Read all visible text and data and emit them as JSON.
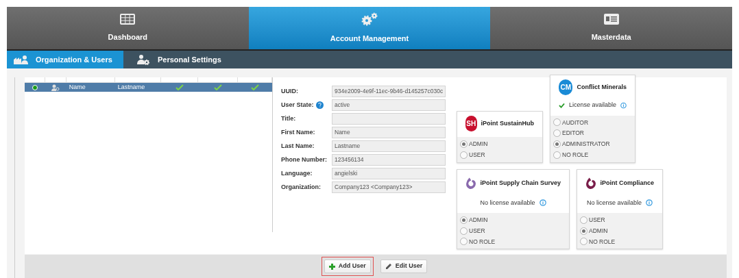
{
  "nav": [
    {
      "label": "Dashboard",
      "kind": "grid",
      "selected": false
    },
    {
      "label": "Account Management",
      "kind": "gears",
      "selected": true
    },
    {
      "label": "Masterdata",
      "kind": "card",
      "selected": false
    }
  ],
  "subnav": [
    {
      "label": "Organization & Users",
      "kind": "org",
      "selected": true
    },
    {
      "label": "Personal Settings",
      "kind": "settings",
      "selected": false
    }
  ],
  "table": {
    "rows": [
      {
        "color": "#1a9a1a",
        "first_name": "Name",
        "last_name": "Lastname",
        "checks": [
          true,
          true,
          true
        ],
        "selected": true
      }
    ]
  },
  "form": [
    {
      "label": "UUID:",
      "value": "934e2009-4e9f-11ec-9b46-d145257c030c"
    },
    {
      "label": "User State:",
      "value": "active",
      "help": true
    },
    {
      "label": "Title:"
    },
    {
      "label": "First Name:",
      "value": "Name"
    },
    {
      "label": "Last Name:",
      "value": "Lastname"
    },
    {
      "label": "Phone Number:",
      "value": "123456134"
    },
    {
      "label": "Language:",
      "value": "angielski"
    },
    {
      "label": "Organization:",
      "value": "Company123 <Company123>"
    }
  ],
  "licenses": [
    {
      "title": "iPoint SustainHub",
      "kind": "badge",
      "badge": "SH",
      "color": "#c8102e",
      "roles": [
        {
          "label": "ADMIN",
          "selected": true
        },
        {
          "label": "USER",
          "selected": false
        }
      ]
    },
    {
      "title": "Conflict Minerals",
      "kind": "badge",
      "badge": "CM",
      "color": "#1a8bd6",
      "license": {
        "available": true,
        "text": "License available"
      },
      "roles": [
        {
          "label": "AUDITOR",
          "selected": false
        },
        {
          "label": "EDITOR",
          "selected": false
        },
        {
          "label": "ADMINISTRATOR",
          "selected": true
        },
        {
          "label": "NO ROLE",
          "selected": false
        }
      ]
    },
    {
      "title": "iPoint Supply Chain Survey",
      "kind": "swirl",
      "color": "#8a6aad",
      "license": {
        "available": false,
        "text": "No license available"
      },
      "roles": [
        {
          "label": "ADMIN",
          "selected": true
        },
        {
          "label": "USER",
          "selected": false
        },
        {
          "label": "NO ROLE",
          "selected": false
        }
      ]
    },
    {
      "title": "iPoint Compliance",
      "kind": "swirl",
      "color": "#7a1e4a",
      "license": {
        "available": false,
        "text": "No license available"
      },
      "roles": [
        {
          "label": "USER",
          "selected": false
        },
        {
          "label": "ADMIN",
          "selected": true
        },
        {
          "label": "NO ROLE",
          "selected": false
        }
      ]
    }
  ],
  "buttons": [
    {
      "label": "Add User",
      "kind": "add",
      "highlighted": true
    },
    {
      "label": "Edit User",
      "kind": "edit",
      "highlighted": false
    }
  ]
}
